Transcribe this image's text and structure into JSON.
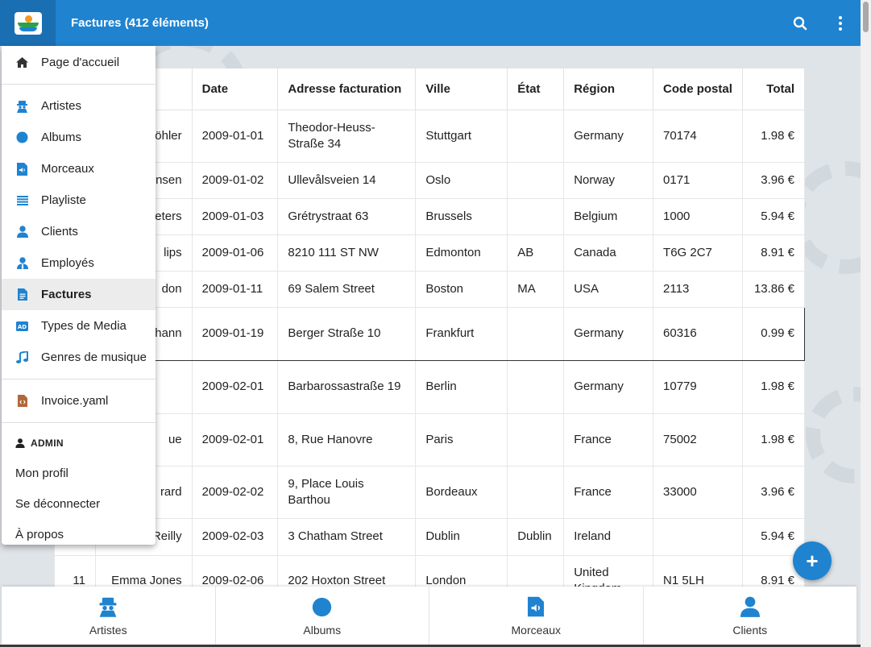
{
  "header": {
    "title": "Factures (412 éléments)",
    "search_icon": "search-icon",
    "more_icon": "more-vert-icon"
  },
  "menu": {
    "items": [
      {
        "label": "Page d'accueil",
        "icon": "home-icon"
      },
      {
        "label": "Artistes",
        "icon": "user-secret-icon"
      },
      {
        "label": "Albums",
        "icon": "circle-icon"
      },
      {
        "label": "Morceaux",
        "icon": "audio-file-icon"
      },
      {
        "label": "Playliste",
        "icon": "list-icon"
      },
      {
        "label": "Clients",
        "icon": "user-icon"
      },
      {
        "label": "Employés",
        "icon": "user-tie-icon"
      },
      {
        "label": "Factures",
        "icon": "invoice-icon",
        "active": true
      },
      {
        "label": "Types de Media",
        "icon": "ad-icon"
      },
      {
        "label": "Genres de musique",
        "icon": "music-note-icon"
      }
    ],
    "yaml_label": "Invoice.yaml",
    "admin_heading": "ADMIN",
    "profile": "Mon profil",
    "logout": "Se déconnecter",
    "about": "À propos"
  },
  "table": {
    "columns": [
      "",
      "",
      "Date",
      "Adresse facturation",
      "Ville",
      "État",
      "Région",
      "Code postal",
      "Total"
    ],
    "rows": [
      {
        "id": "",
        "client": "öhler",
        "date": "2009-01-01",
        "address": "Theodor-Heuss-Straße 34",
        "city": "Stuttgart",
        "state": "",
        "region": "Germany",
        "postal": "70174",
        "total": "1.98 €"
      },
      {
        "id": "",
        "client": "nsen",
        "date": "2009-01-02",
        "address": "Ullevålsveien 14",
        "city": "Oslo",
        "state": "",
        "region": "Norway",
        "postal": "0171",
        "total": "3.96 €"
      },
      {
        "id": "",
        "client": "eters",
        "date": "2009-01-03",
        "address": "Grétrystraat 63",
        "city": "Brussels",
        "state": "",
        "region": "Belgium",
        "postal": "1000",
        "total": "5.94 €"
      },
      {
        "id": "",
        "client": "lips",
        "date": "2009-01-06",
        "address": "8210 111 ST NW",
        "city": "Edmonton",
        "state": "AB",
        "region": "Canada",
        "postal": "T6G 2C7",
        "total": "8.91 €"
      },
      {
        "id": "",
        "client": "don",
        "date": "2009-01-11",
        "address": "69 Salem Street",
        "city": "Boston",
        "state": "MA",
        "region": "USA",
        "postal": "2113",
        "total": "13.86 €"
      },
      {
        "id": "",
        "client": "hann",
        "date": "2009-01-19",
        "address": "Berger Straße 10",
        "city": "Frankfurt",
        "state": "",
        "region": "Germany",
        "postal": "60316",
        "total": "0.99 €",
        "selected": true
      },
      {
        "id": "",
        "client": "",
        "date": "2009-02-01",
        "address": "Barbarossastraße 19",
        "city": "Berlin",
        "state": "",
        "region": "Germany",
        "postal": "10779",
        "total": "1.98 €"
      },
      {
        "id": "",
        "client": "ue",
        "date": "2009-02-01",
        "address": "8, Rue Hanovre",
        "city": "Paris",
        "state": "",
        "region": "France",
        "postal": "75002",
        "total": "1.98 €"
      },
      {
        "id": "",
        "client": "rard",
        "date": "2009-02-02",
        "address": "9, Place Louis Barthou",
        "city": "Bordeaux",
        "state": "",
        "region": "France",
        "postal": "33000",
        "total": "3.96 €"
      },
      {
        "id": "",
        "client": "Reilly",
        "date": "2009-02-03",
        "address": "3 Chatham Street",
        "city": "Dublin",
        "state": "Dublin",
        "region": "Ireland",
        "postal": "",
        "total": "5.94 €"
      },
      {
        "id": "11",
        "client": "Emma Jones",
        "date": "2009-02-06",
        "address": "202 Hoxton Street",
        "city": "London",
        "state": "",
        "region": "United Kingdom",
        "postal": "N1 5LH",
        "total": "8.91 €"
      }
    ]
  },
  "fab": {
    "label": "+"
  },
  "bottom_nav": [
    {
      "label": "Artistes",
      "icon": "user-secret-icon"
    },
    {
      "label": "Albums",
      "icon": "circle-icon"
    },
    {
      "label": "Morceaux",
      "icon": "audio-file-icon"
    },
    {
      "label": "Clients",
      "icon": "user-icon"
    }
  ],
  "colors": {
    "primary": "#1f83d0",
    "primary_dark": "#1a6fb2",
    "active_menu_bg": "#ececec"
  }
}
